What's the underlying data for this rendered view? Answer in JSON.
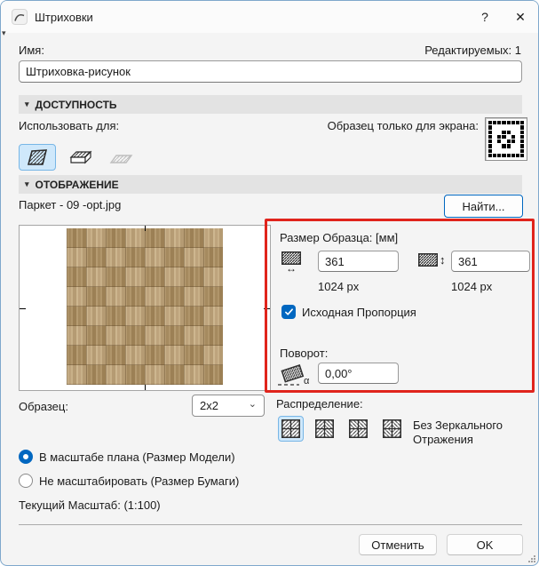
{
  "titlebar": {
    "title": "Штриховки",
    "help": "?",
    "close": "✕"
  },
  "icons": {
    "collapse": "▾",
    "dropdown": "⌄",
    "width_arrow": "↔",
    "height_arrow": "↕",
    "alpha": "α"
  },
  "name": {
    "label": "Имя:",
    "editable_count": "Редактируемых: 1",
    "value": "Штриховка-рисунок"
  },
  "availability_section": {
    "header": "ДОСТУПНОСТЬ",
    "use_for_label": "Использовать для:",
    "screen_sample_label": "Образец только для экрана:",
    "screen_sample_pattern": [
      "11111111",
      "10000001",
      "10011001",
      "10110101",
      "10101101",
      "10011001",
      "10000001",
      "11111111"
    ]
  },
  "display_section": {
    "header": "ОТОБРАЖЕНИЕ",
    "filename": "Паркет - 09 -opt.jpg",
    "find_button": "Найти...",
    "size_label": "Размер Образца: [мм]",
    "width_value": "361",
    "width_pixels": "1024 px",
    "height_value": "361",
    "height_pixels": "1024 px",
    "proportion_checkbox": "Исходная Пропорция",
    "rotation_label": "Поворот:",
    "rotation_value": "0,00°"
  },
  "pattern_row": {
    "sample_label": "Образец:",
    "sample_value": "2x2",
    "distribution_label": "Распределение:",
    "mirror_status": "Без Зеркального Отражения"
  },
  "scale_options": {
    "model": "В масштабе плана (Размер Модели)",
    "paper": "Не масштабировать (Размер Бумаги)",
    "current_scale": "Текущий Масштаб: (1:100)"
  },
  "footer": {
    "cancel": "Отменить",
    "ok": "OK"
  },
  "colors": {
    "accent": "#0067c0",
    "highlight_frame": "#e0241c",
    "selected_bg": "#cfe8fb"
  }
}
